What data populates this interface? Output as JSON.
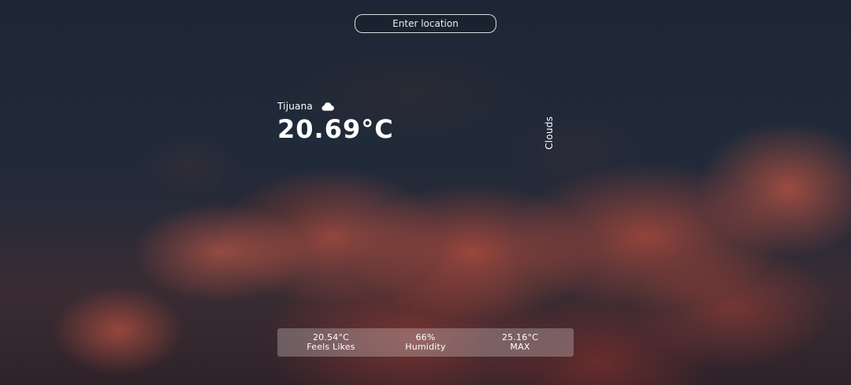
{
  "search": {
    "placeholder": "Enter location"
  },
  "weather": {
    "city": "Tijuana",
    "icon": "cloud-icon",
    "temperature": "20.69°C",
    "condition": "Clouds"
  },
  "stats": [
    {
      "value": "20.54°C",
      "label": "Feels Likes"
    },
    {
      "value": "66%",
      "label": "Humidity"
    },
    {
      "value": "25.16°C",
      "label": "MAX"
    }
  ],
  "colors": {
    "background": "#1f2735",
    "cloud_accent": "#e05a44",
    "text": "#ffffff",
    "stats_bar": "rgba(255,255,255,0.25)"
  }
}
